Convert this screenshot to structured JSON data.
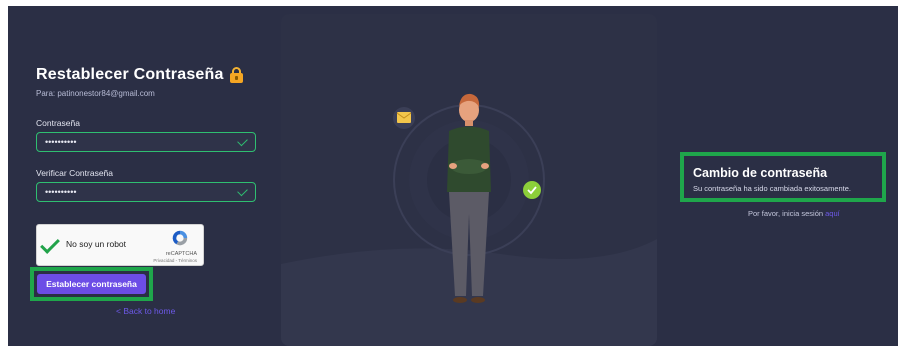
{
  "form": {
    "title": "Restablecer Contraseña",
    "recipient": "Para: patinonestor84@gmail.com",
    "password_label": "Contraseña",
    "password_value": "••••••••••",
    "confirm_label": "Verificar Contraseña",
    "confirm_value": "••••••••••",
    "submit_label": "Establecer contraseña",
    "back_label": "< Back to home"
  },
  "captcha": {
    "label": "No soy un robot",
    "brand": "reCAPTCHA",
    "terms": "Privacidad - Términos"
  },
  "result": {
    "title": "Cambio de contraseña",
    "message": "Su contraseña ha sido cambiada exitosamente.",
    "login_prompt": "Por favor, inicia sesión",
    "login_link": "aquí"
  },
  "colors": {
    "background": "#2b2f45",
    "accent": "#6c4de6",
    "success": "#2fbf71",
    "highlight": "#1fa64b"
  }
}
